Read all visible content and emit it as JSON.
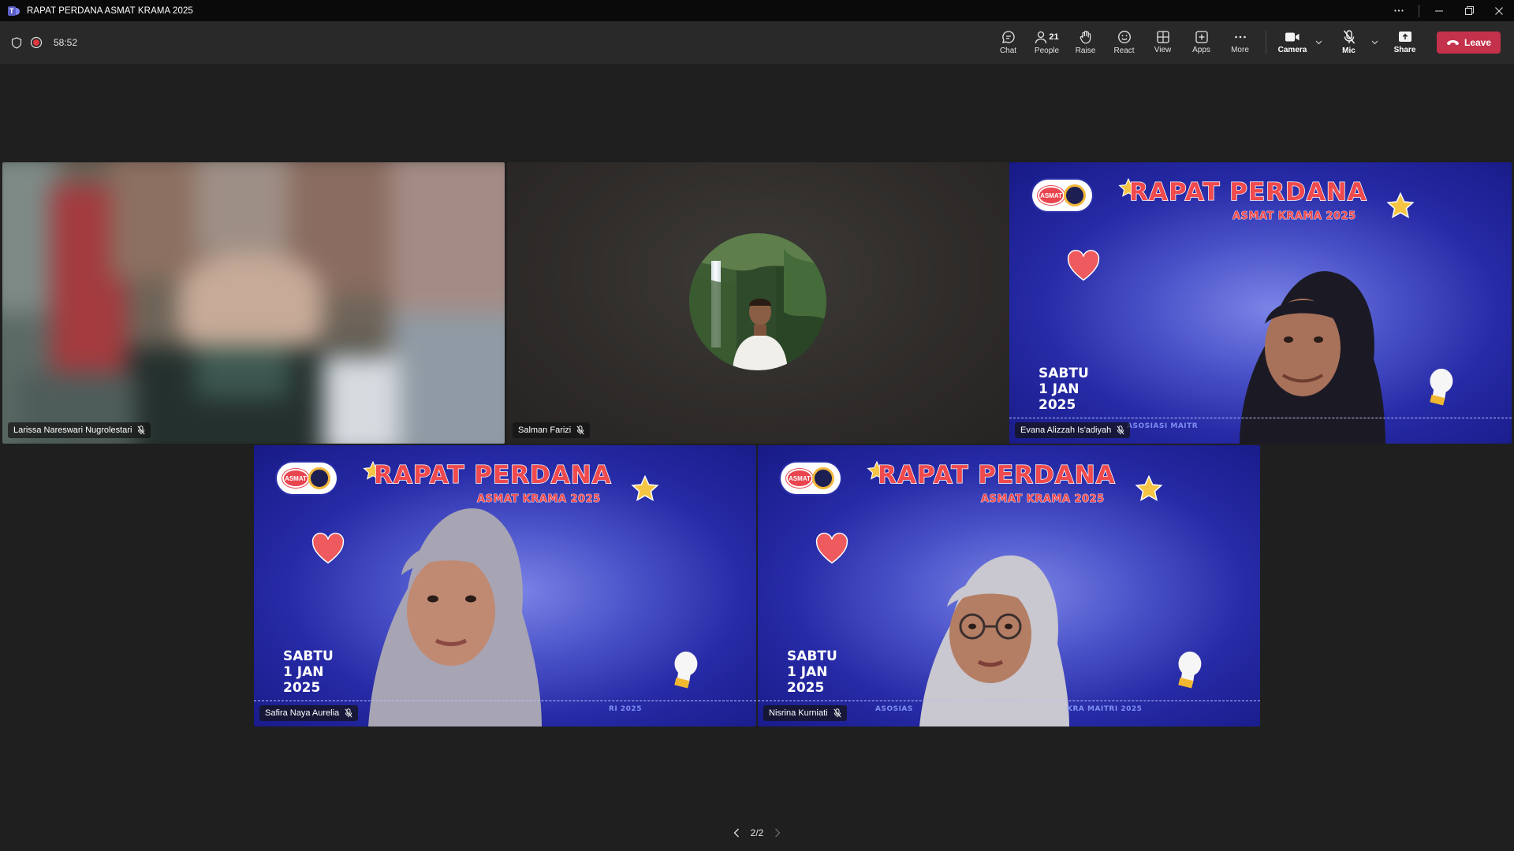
{
  "window": {
    "title": "RAPAT PERDANA ASMAT KRAMA 2025"
  },
  "meeting": {
    "timer": "58:52"
  },
  "toolbar": {
    "chat": "Chat",
    "people": "People",
    "people_count": "21",
    "raise": "Raise",
    "react": "React",
    "view": "View",
    "apps": "Apps",
    "more": "More",
    "camera": "Camera",
    "mic": "Mic",
    "share": "Share",
    "leave": "Leave"
  },
  "participants": [
    {
      "name": "Larissa Nareswari Nugrolestari",
      "muted": true,
      "video": "blurred"
    },
    {
      "name": "Salman Farizi",
      "muted": true,
      "video": "avatar"
    },
    {
      "name": "Evana Alizzah Is'adiyah",
      "muted": true,
      "video": "background"
    },
    {
      "name": "Safira Naya Aurelia",
      "muted": true,
      "video": "background"
    },
    {
      "name": "Nisrina Kurniati",
      "muted": true,
      "video": "background"
    }
  ],
  "banner": {
    "title": "RAPAT PERDANA",
    "subtitle": "ASMAT KRAMA 2025",
    "date_line1": "SABTU",
    "date_line2": "1 JAN",
    "date_line3": "2025",
    "logo_text": "ASMAT",
    "footer_left": "ASOSIASI MAITR",
    "footer_right": "KRA MAITRI 2025",
    "footer_a": "ASOSIAS",
    "footer_b": "RI 2025",
    "colors": {
      "bg": "#262aa5",
      "title": "#ef4a4e",
      "star": "#f6c544",
      "heart": "#ef5a5e"
    }
  },
  "pager": {
    "label": "2/2"
  },
  "colors": {
    "leave": "#c4314b",
    "toolbar": "#292929",
    "titlebar": "#0a0a0a",
    "stage": "#1f1f1f"
  }
}
